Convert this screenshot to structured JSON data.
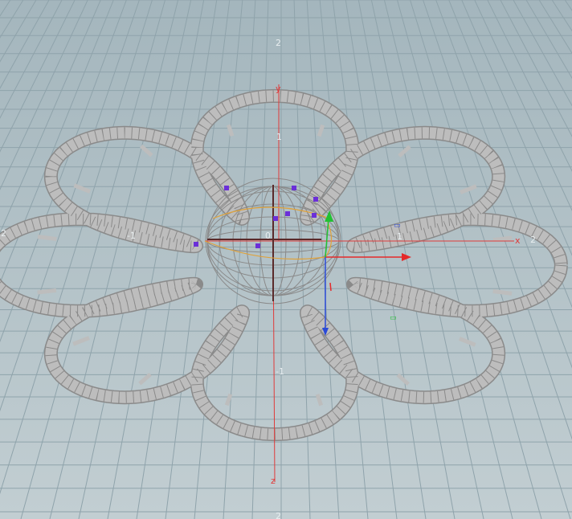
{
  "viewport": {
    "background_top": "#a4b6bd",
    "background_bottom": "#c2ced2",
    "grid_color": "#8fa3ab",
    "grid_major_color": "#7f959e"
  },
  "axes": {
    "x_label": "x",
    "y_label": "y",
    "z_label": "z",
    "x_color": "#e03a3a",
    "y_color": "#e03a3a",
    "z_color": "#e03a3a",
    "origin_label": "0",
    "tick_x_pos1": "1",
    "tick_x_pos2": "2",
    "tick_x_neg1": "-1",
    "tick_x_neg2": "2",
    "tick_z_neg1": "-1",
    "tick_top": "2",
    "tick_bottom": "2",
    "tick_y_1": "1"
  },
  "gizmo": {
    "x_color": "#e52a2a",
    "y_color": "#21c233",
    "z_color": "#2a4ad8",
    "handle_color": "#6b2fd8",
    "curve_color": "#e0a23a"
  },
  "model": {
    "tube_color": "#bdbdbd",
    "tube_edge_color": "#8a8a8a",
    "petal_count": "8"
  }
}
